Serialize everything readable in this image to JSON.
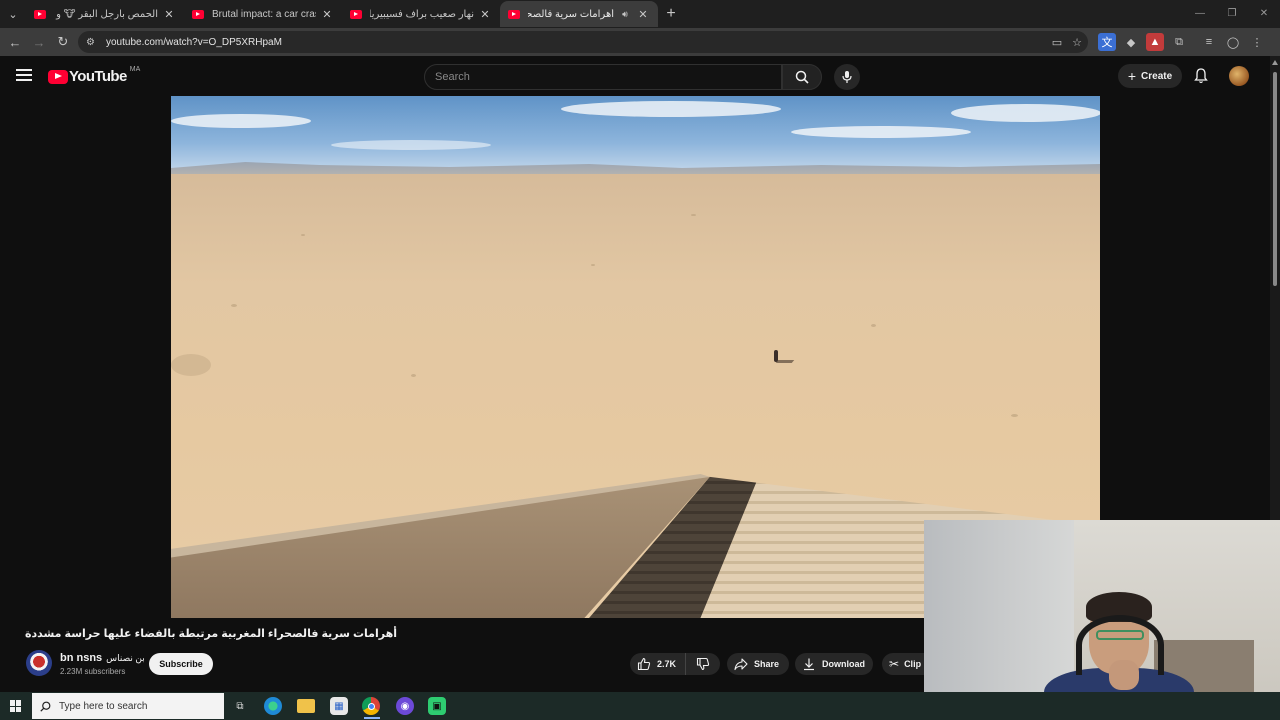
{
  "browser": {
    "tabs": [
      {
        "title": "الحمص بأرجل البقر 🐮 و تقليم أ",
        "active": false
      },
      {
        "title": "Brutal impact: a car crashes",
        "active": false
      },
      {
        "title": "نهار صعيب براف فسيبيريا ❄️ جلد",
        "active": false
      },
      {
        "title": "أهرامات سرية فالصحراء المغ",
        "active": true
      }
    ],
    "url": "youtube.com/watch?v=O_DP5XRHpaM"
  },
  "youtube": {
    "logo_text": "YouTube",
    "country_code": "MA",
    "search_placeholder": "Search",
    "create_label": "Create"
  },
  "video": {
    "title": "أهرامات سرية فالصحراء المغربية مرتبطة بالفضاء عليها حراسة مشددة",
    "channel_name": "bn nsns",
    "channel_name_ar": "بن نصناس",
    "subscribers": "2.23M subscribers",
    "subscribe_label": "Subscribe",
    "likes": "2.7K",
    "share_label": "Share",
    "download_label": "Download",
    "clip_label": "Clip"
  },
  "taskbar": {
    "search_placeholder": "Type here to search"
  },
  "colors": {
    "youtube_red": "#ff0033",
    "background": "#0f0f0f",
    "taskbar": "#1c2a27"
  }
}
